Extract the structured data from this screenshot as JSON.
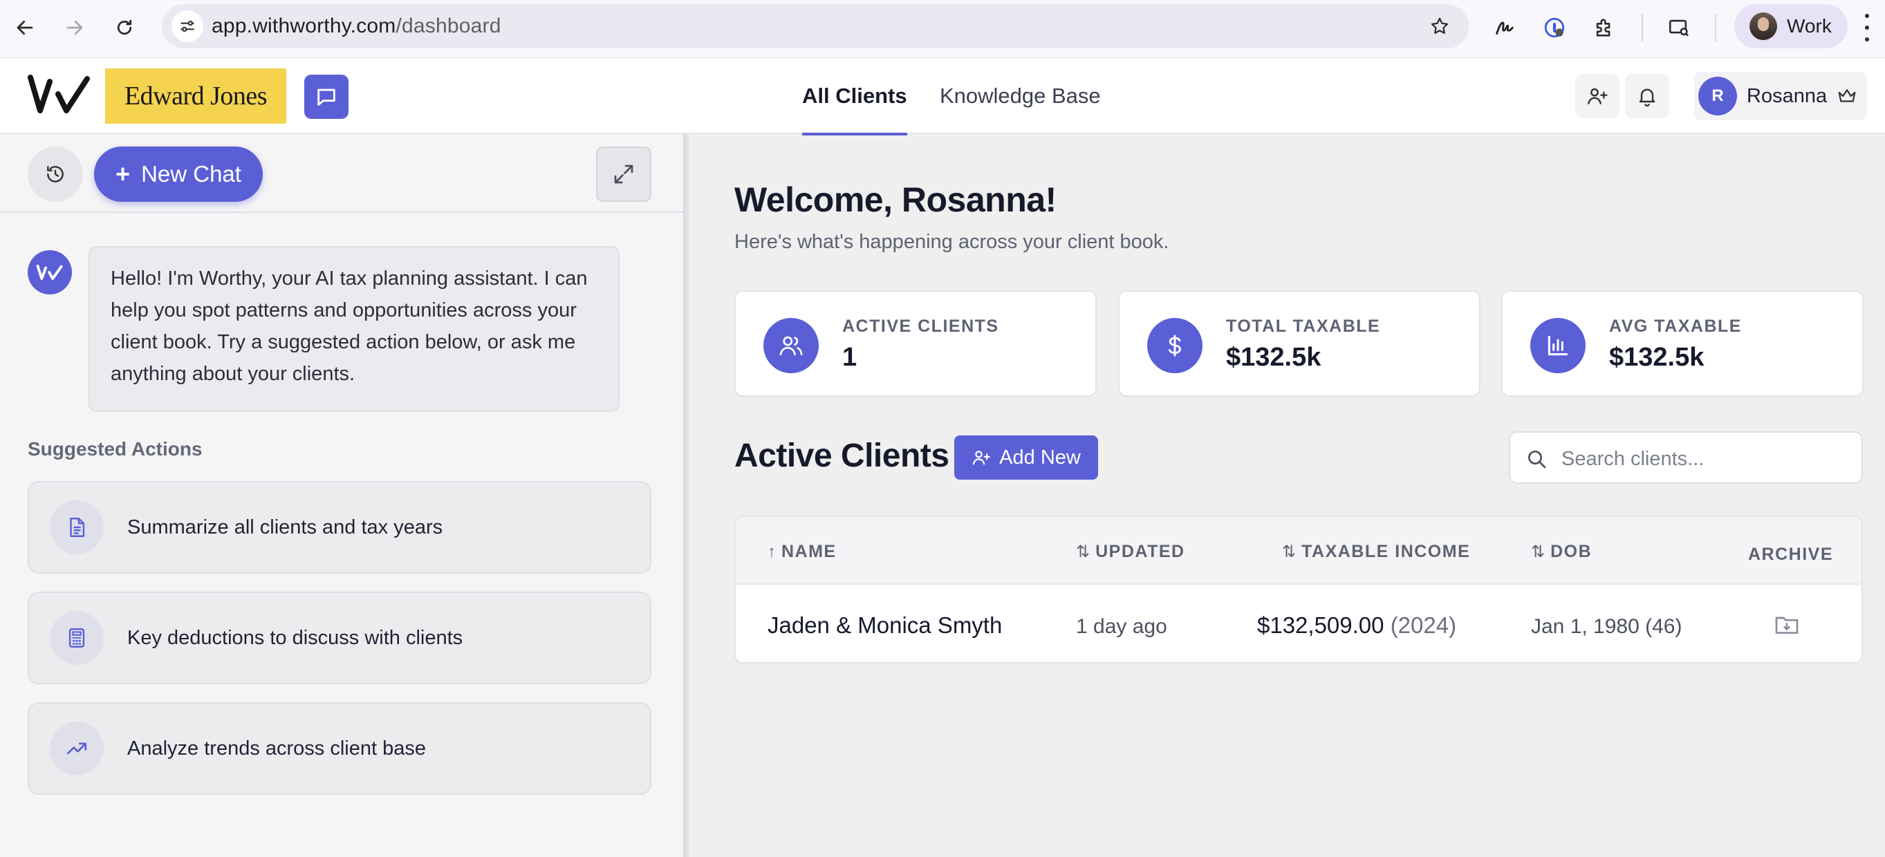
{
  "browser": {
    "url_host": "app.withworthy.com",
    "url_path": "/dashboard",
    "profile_label": "Work"
  },
  "header": {
    "brand": "Edward Jones",
    "tabs": [
      {
        "label": "All Clients",
        "active": true
      },
      {
        "label": "Knowledge Base",
        "active": false
      }
    ],
    "user_initial": "R",
    "user_name": "Rosanna"
  },
  "chat": {
    "new_chat_label": "New Chat",
    "greeting": "Hello! I'm Worthy, your AI tax planning assistant. I can help you spot patterns and opportunities across your client book. Try a suggested action below, or ask me anything about your clients.",
    "suggested_title": "Suggested Actions",
    "suggestions": [
      {
        "label": "Summarize all clients and tax years",
        "icon": "document-icon"
      },
      {
        "label": "Key deductions to discuss with clients",
        "icon": "calculator-icon"
      },
      {
        "label": "Analyze trends across client base",
        "icon": "trending-up-icon"
      }
    ]
  },
  "dashboard": {
    "welcome": "Welcome, Rosanna!",
    "subtitle": "Here's what's happening across your client book.",
    "stats": [
      {
        "label": "ACTIVE CLIENTS",
        "value": "1",
        "icon": "users-icon"
      },
      {
        "label": "TOTAL TAXABLE",
        "value": "$132.5k",
        "icon": "dollar-icon"
      },
      {
        "label": "AVG TAXABLE",
        "value": "$132.5k",
        "icon": "bar-chart-icon"
      }
    ],
    "section_title": "Active Clients",
    "add_new_label": "Add New",
    "search_placeholder": "Search clients...",
    "columns": {
      "name": "NAME",
      "updated": "UPDATED",
      "income": "TAXABLE INCOME",
      "dob": "DOB",
      "archive": "ARCHIVE"
    },
    "rows": [
      {
        "name": "Jaden & Monica Smyth",
        "updated": "1 day ago",
        "income": "$132,509.00",
        "income_year": "(2024)",
        "dob": "Jan 1, 1980 (46)"
      }
    ]
  },
  "colors": {
    "accent": "#5b5fd6",
    "brand_yellow": "#f5d34f"
  }
}
